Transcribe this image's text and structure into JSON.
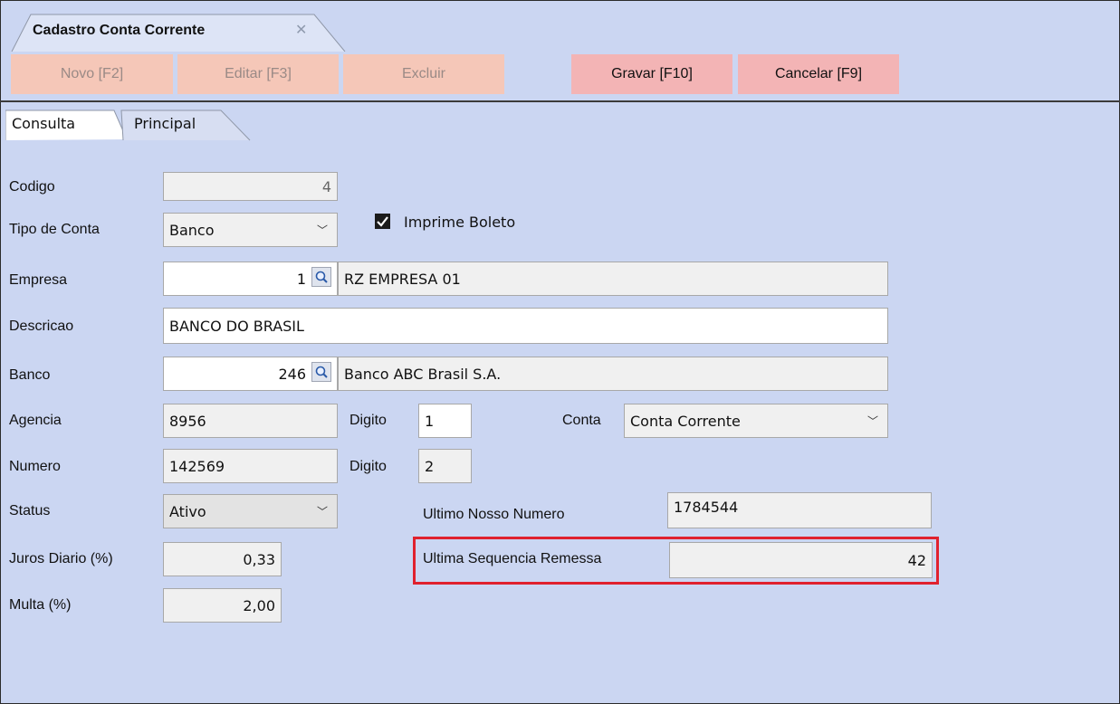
{
  "tab": {
    "title": "Cadastro Conta Corrente",
    "close_glyph": "✕"
  },
  "toolbar": {
    "novo": "Novo [F2]",
    "editar": "Editar [F3]",
    "excluir": "Excluir",
    "gravar": "Gravar [F10]",
    "cancelar": "Cancelar [F9]"
  },
  "subtabs": {
    "consulta": "Consulta",
    "principal": "Principal"
  },
  "form": {
    "codigo_label": "Codigo",
    "codigo_value": "4",
    "tipo_conta_label": "Tipo de Conta",
    "tipo_conta_value": "Banco",
    "imprime_boleto_label": "Imprime Boleto",
    "imprime_boleto_checked": true,
    "empresa_label": "Empresa",
    "empresa_code": "1",
    "empresa_name": "RZ EMPRESA 01",
    "descricao_label": "Descricao",
    "descricao_value": "BANCO DO BRASIL",
    "banco_label": "Banco",
    "banco_code": "246",
    "banco_name": "Banco ABC Brasil S.A.",
    "agencia_label": "Agencia",
    "agencia_value": "8956",
    "digito_label": "Digito",
    "agencia_digito": "1",
    "conta_label": "Conta",
    "conta_value": "Conta Corrente",
    "numero_label": "Numero",
    "numero_value": "142569",
    "numero_digito_label": "Digito",
    "numero_digito": "2",
    "status_label": "Status",
    "status_value": "Ativo",
    "ultimo_nosso_numero_label": "Ultimo Nosso Numero",
    "ultimo_nosso_numero_value": "1784544",
    "juros_label": "Juros Diario (%)",
    "juros_value": "0,33",
    "ultima_seq_label": "Ultima Sequencia Remessa",
    "ultima_seq_value": "42",
    "multa_label": "Multa (%)",
    "multa_value": "2,00"
  },
  "colors": {
    "background": "#cbd6f2",
    "highlight": "#e0212e",
    "button_disabled": "#f5c7b8",
    "button_active": "#f3b4b5"
  }
}
